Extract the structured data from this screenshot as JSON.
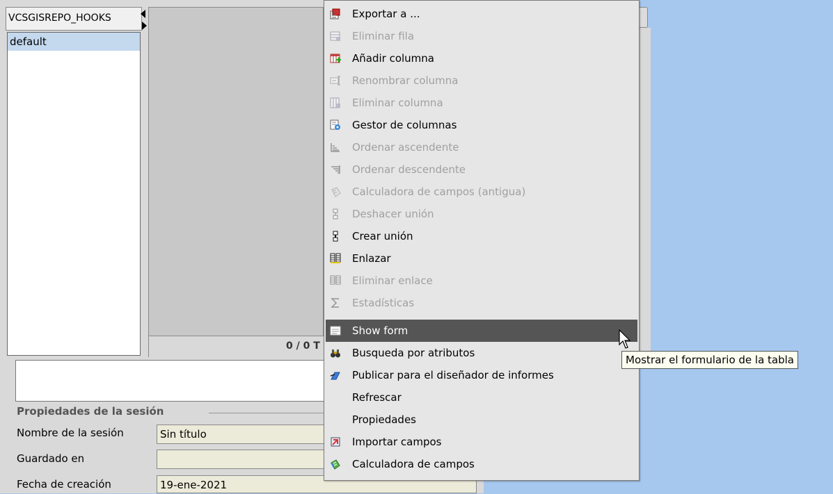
{
  "left_panel": {
    "table_tab": "VCSGISREPO_HOOKS",
    "items": [
      "default"
    ]
  },
  "status_bar": {
    "text": "0 / 0 T"
  },
  "session": {
    "group_title": "Propiedades de la sesión",
    "name_label": "Nombre de la sesión",
    "name_value": "Sin título",
    "saved_label": "Guardado en",
    "saved_value": "",
    "date_label": "Fecha de creación",
    "date_value": "19-ene-2021"
  },
  "menu": {
    "items": [
      {
        "label": "Exportar a ...",
        "icon": "export-icon",
        "enabled": true
      },
      {
        "label": "Eliminar fila",
        "icon": "delete-row-icon",
        "enabled": false
      },
      {
        "label": "Añadir columna",
        "icon": "add-column-icon",
        "enabled": true
      },
      {
        "label": "Renombrar columna",
        "icon": "rename-column-icon",
        "enabled": false
      },
      {
        "label": "Eliminar columna",
        "icon": "delete-column-icon",
        "enabled": false
      },
      {
        "label": "Gestor de columnas",
        "icon": "column-manager-icon",
        "enabled": true
      },
      {
        "label": "Ordenar ascendente",
        "icon": "sort-ascending-icon",
        "enabled": false
      },
      {
        "label": "Ordenar descendente",
        "icon": "sort-descending-icon",
        "enabled": false
      },
      {
        "label": "Calculadora de campos (antigua)",
        "icon": "field-calculator-old-icon",
        "enabled": false
      },
      {
        "label": "Deshacer unión",
        "icon": "undo-join-icon",
        "enabled": false
      },
      {
        "label": "Crear unión",
        "icon": "create-join-icon",
        "enabled": true
      },
      {
        "label": "Enlazar",
        "icon": "link-icon",
        "enabled": true
      },
      {
        "label": "Eliminar enlace",
        "icon": "unlink-icon",
        "enabled": false
      },
      {
        "label": "Estadísticas",
        "icon": "statistics-icon",
        "enabled": false
      },
      {
        "label": "Show form",
        "icon": "form-icon",
        "enabled": true,
        "highlighted": true
      },
      {
        "label": "Busqueda por atributos",
        "icon": "binoculars-icon",
        "enabled": true
      },
      {
        "label": "Publicar para el diseñador de informes",
        "icon": "publish-icon",
        "enabled": true
      },
      {
        "label": "Refrescar",
        "icon": "",
        "enabled": true
      },
      {
        "label": "Propiedades",
        "icon": "",
        "enabled": true
      },
      {
        "label": "Importar campos",
        "icon": "import-fields-icon",
        "enabled": true
      },
      {
        "label": "Calculadora de campos",
        "icon": "field-calculator-icon",
        "enabled": true
      }
    ]
  },
  "tooltip": "Mostrar el formulario de la tabla",
  "colors": {
    "desktop_bg": "#a7c8ee",
    "menu_bg": "#e6e6e6",
    "highlight_bg": "#555555",
    "disabled_text": "#a0a0a0",
    "field_bg": "#ecebd9"
  }
}
